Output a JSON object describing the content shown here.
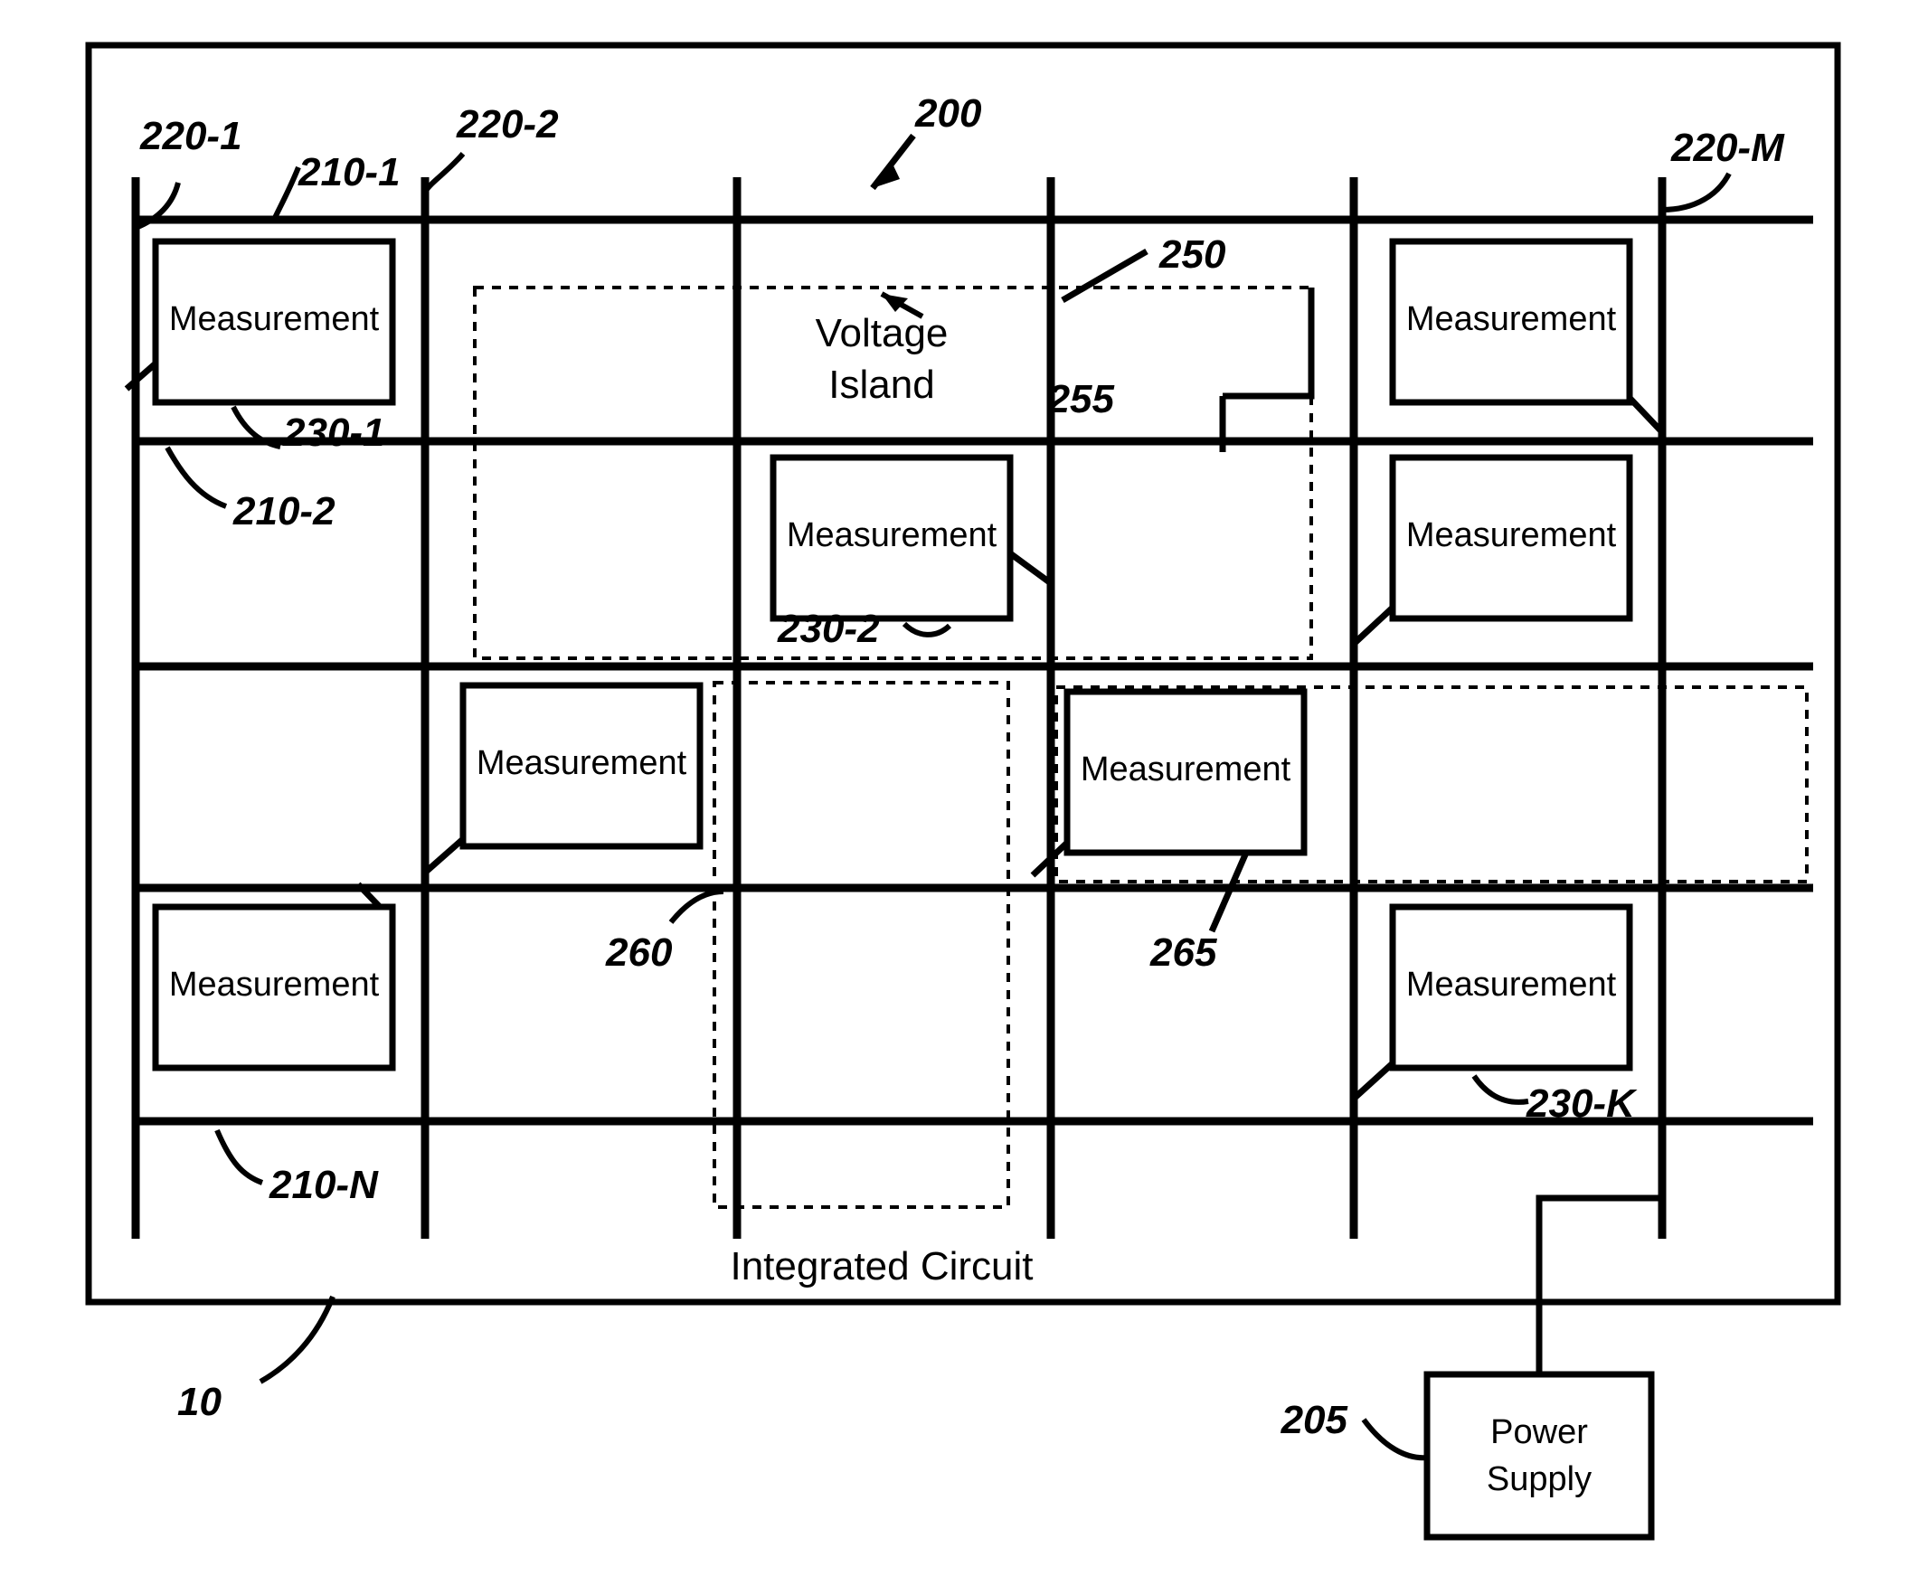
{
  "figure": {
    "title_text": "Integrated Circuit",
    "voltage_island_line1": "Voltage",
    "voltage_island_line2": "Island",
    "power_supply_line1": "Power",
    "power_supply_line2": "Supply",
    "measurement_label": "Measurement",
    "line_color": "#000000",
    "background_color": "#ffffff"
  },
  "reference_numerals": {
    "chip": "10",
    "power_supply": "205",
    "grid_200": "200",
    "row_1": "210-1",
    "row_2": "210-2",
    "row_n": "210-N",
    "col_1": "220-1",
    "col_2": "220-2",
    "col_m": "220-M",
    "meas_1": "230-1",
    "meas_2": "230-2",
    "meas_k": "230-K",
    "island_250": "250",
    "island_255": "255",
    "island_260": "260",
    "island_265": "265"
  },
  "measurement_circuits": [
    {
      "id": "meas-r1c1",
      "label": "Measurement"
    },
    {
      "id": "meas-r1c5",
      "label": "Measurement"
    },
    {
      "id": "meas-r2c3",
      "label": "Measurement"
    },
    {
      "id": "meas-r2c5",
      "label": "Measurement"
    },
    {
      "id": "meas-r3c2",
      "label": "Measurement"
    },
    {
      "id": "meas-r3c4",
      "label": "Measurement"
    },
    {
      "id": "meas-r4c1",
      "label": "Measurement"
    },
    {
      "id": "meas-r4c5",
      "label": "Measurement"
    }
  ],
  "voltage_islands": [
    {
      "id": "island-250",
      "numeral": "250"
    },
    {
      "id": "island-255",
      "numeral": "255"
    },
    {
      "id": "island-260",
      "numeral": "260"
    },
    {
      "id": "island-265",
      "numeral": "265"
    }
  ]
}
